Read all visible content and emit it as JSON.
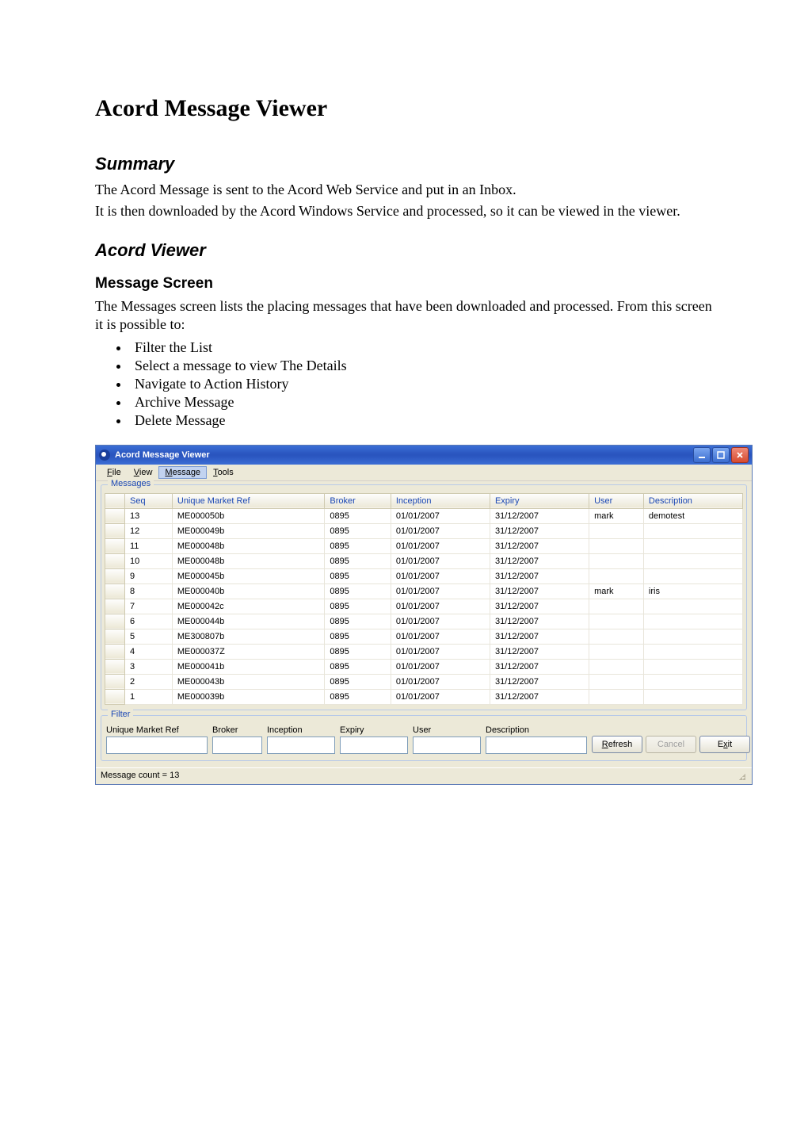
{
  "doc": {
    "title": "Acord Message Viewer",
    "summary_heading": "Summary",
    "summary_p1": "The Acord Message is sent to the Acord Web Service and put in an Inbox.",
    "summary_p2": "It is then downloaded by the Acord Windows Service and processed, so it can be viewed in the viewer.",
    "viewer_heading": "Acord Viewer",
    "msg_screen_heading": "Message Screen",
    "msg_screen_p": "The Messages screen lists the placing messages that have been downloaded and processed. From this screen it is possible to:",
    "bullets": [
      "Filter the List",
      "Select a message to view The Details",
      "Navigate to Action History",
      "Archive Message",
      "Delete Message"
    ]
  },
  "app": {
    "title": "Acord Message Viewer",
    "menu": {
      "file": "File",
      "view": "View",
      "message": "Message",
      "tools": "Tools"
    },
    "messages_group": "Messages",
    "columns": {
      "seq": "Seq",
      "umr": "Unique Market Ref",
      "broker": "Broker",
      "inception": "Inception",
      "expiry": "Expiry",
      "user": "User",
      "description": "Description"
    },
    "rows": [
      {
        "seq": "13",
        "umr": "ME000050b",
        "broker": "0895",
        "inception": "01/01/2007",
        "expiry": "31/12/2007",
        "user": "mark",
        "desc": "demotest"
      },
      {
        "seq": "12",
        "umr": "ME000049b",
        "broker": "0895",
        "inception": "01/01/2007",
        "expiry": "31/12/2007",
        "user": "",
        "desc": ""
      },
      {
        "seq": "11",
        "umr": "ME000048b",
        "broker": "0895",
        "inception": "01/01/2007",
        "expiry": "31/12/2007",
        "user": "",
        "desc": ""
      },
      {
        "seq": "10",
        "umr": "ME000048b",
        "broker": "0895",
        "inception": "01/01/2007",
        "expiry": "31/12/2007",
        "user": "",
        "desc": ""
      },
      {
        "seq": "9",
        "umr": "ME000045b",
        "broker": "0895",
        "inception": "01/01/2007",
        "expiry": "31/12/2007",
        "user": "",
        "desc": ""
      },
      {
        "seq": "8",
        "umr": "ME000040b",
        "broker": "0895",
        "inception": "01/01/2007",
        "expiry": "31/12/2007",
        "user": "mark",
        "desc": "iris"
      },
      {
        "seq": "7",
        "umr": "ME000042c",
        "broker": "0895",
        "inception": "01/01/2007",
        "expiry": "31/12/2007",
        "user": "",
        "desc": ""
      },
      {
        "seq": "6",
        "umr": "ME000044b",
        "broker": "0895",
        "inception": "01/01/2007",
        "expiry": "31/12/2007",
        "user": "",
        "desc": ""
      },
      {
        "seq": "5",
        "umr": "ME300807b",
        "broker": "0895",
        "inception": "01/01/2007",
        "expiry": "31/12/2007",
        "user": "",
        "desc": ""
      },
      {
        "seq": "4",
        "umr": "ME000037Z",
        "broker": "0895",
        "inception": "01/01/2007",
        "expiry": "31/12/2007",
        "user": "",
        "desc": ""
      },
      {
        "seq": "3",
        "umr": "ME000041b",
        "broker": "0895",
        "inception": "01/01/2007",
        "expiry": "31/12/2007",
        "user": "",
        "desc": ""
      },
      {
        "seq": "2",
        "umr": "ME000043b",
        "broker": "0895",
        "inception": "01/01/2007",
        "expiry": "31/12/2007",
        "user": "",
        "desc": ""
      },
      {
        "seq": "1",
        "umr": "ME000039b",
        "broker": "0895",
        "inception": "01/01/2007",
        "expiry": "31/12/2007",
        "user": "",
        "desc": ""
      }
    ],
    "filter_group": "Filter",
    "filter_labels": {
      "umr": "Unique Market Ref",
      "broker": "Broker",
      "inception": "Inception",
      "expiry": "Expiry",
      "user": "User",
      "description": "Description"
    },
    "buttons": {
      "refresh": "Refresh",
      "cancel": "Cancel",
      "exit": "Exit"
    },
    "status": "Message count = 13"
  }
}
